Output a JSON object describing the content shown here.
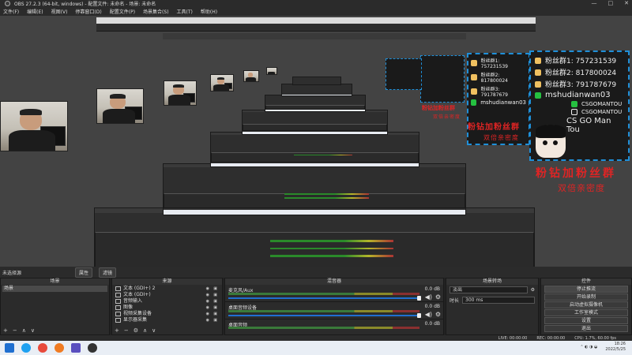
{
  "window": {
    "title": "OBS 27.2.3 (64-bit, windows) - 配置文件: 未命名 - 场景: 未命名",
    "controls": [
      "—",
      "□",
      "✕"
    ]
  },
  "menu": [
    "文件(F)",
    "编辑(E)",
    "视图(V)",
    "停靠窗口(D)",
    "配置文件(P)",
    "场景集合(S)",
    "工具(T)",
    "帮助(H)"
  ],
  "overlay": {
    "fans": [
      "粉丝群1: 757231539",
      "粉丝群2: 817800024",
      "粉丝群3: 791787679"
    ],
    "wechat": "mshudianwan03",
    "douyin": "CSGOMANTOU",
    "channel": "CSGOMANTOU",
    "name": "CS GO Man Tou",
    "promo_line1": "粉钻加粉丝群",
    "promo_line2": "双倍亲密度"
  },
  "status_line": {
    "label": "未选择源",
    "properties": "属性",
    "filters": "滤镜"
  },
  "scenes": {
    "title": "场景",
    "items": [
      "场景"
    ],
    "footer": [
      "+",
      "−",
      "∧",
      "∨"
    ]
  },
  "sources": {
    "title": "来源",
    "items": [
      {
        "icon": "text-icon",
        "label": "文本 (GDI+) 2"
      },
      {
        "icon": "text-icon",
        "label": "文本 (GDI+)"
      },
      {
        "icon": "audio-icon",
        "label": "音频输入"
      },
      {
        "icon": "image-icon",
        "label": "图像"
      },
      {
        "icon": "camera-icon",
        "label": "视频采集设备"
      },
      {
        "icon": "monitor-icon",
        "label": "显示器采集"
      }
    ],
    "footer": [
      "+",
      "−",
      "⚙",
      "∧",
      "∨"
    ]
  },
  "mixer": {
    "title": "混音器",
    "channels": [
      {
        "name": "麦克风/Aux",
        "db": "0.0 dB"
      },
      {
        "name": "桌面音频设备",
        "db": "0.0 dB"
      },
      {
        "name": "视频采集设备",
        "db": "0.0 dB"
      },
      {
        "name": "桌面音频",
        "db": "0.0 dB"
      }
    ]
  },
  "transitions": {
    "title": "场景转场",
    "type": "淡出",
    "duration_label": "时长",
    "duration": "300 ms"
  },
  "controls": {
    "title": "控件",
    "buttons": [
      "停止推流",
      "开始录制",
      "启动虚拟摄像机",
      "工作室模式",
      "设置",
      "退出"
    ]
  },
  "obs_status": {
    "live": "LIVE: 00:00:00",
    "rec": "REC: 00:00:00",
    "cpu": "CPU: 1.7%, 60.00 fps"
  },
  "taskbar": {
    "apps": [
      {
        "name": "start-icon",
        "color": "#1f6fd0"
      },
      {
        "name": "edge-icon",
        "color": "#1ea1f1"
      },
      {
        "name": "chrome-icon",
        "color": "#e84a3c"
      },
      {
        "name": "firefox-icon",
        "color": "#f07b22"
      },
      {
        "name": "shield-app-icon",
        "color": "#5a4fbf"
      },
      {
        "name": "obs-icon",
        "color": "#333333"
      }
    ],
    "time": "18:26",
    "date": "2022/5/25"
  }
}
